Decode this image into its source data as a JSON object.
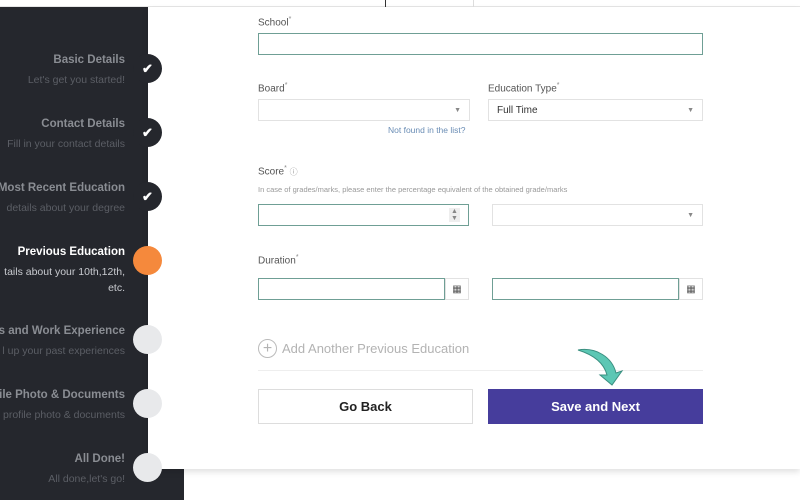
{
  "steps": [
    {
      "title": "Basic Details",
      "subtitle": "Let's get you started!",
      "state": "done"
    },
    {
      "title": "Contact Details",
      "subtitle": "Fill in your contact details",
      "state": "done"
    },
    {
      "title": "/ Most Recent Education",
      "subtitle": "details about your degree",
      "state": "done"
    },
    {
      "title": "Previous Education",
      "subtitle": "tails about your 10th,12th,",
      "subtitle2": "etc.",
      "state": "current"
    },
    {
      "title": "ps and Work Experience",
      "subtitle": "l up your past experiences",
      "state": "todo"
    },
    {
      "title": "ofile Photo & Documents",
      "subtitle": "profile photo & documents",
      "state": "todo"
    },
    {
      "title": "All Done!",
      "subtitle": "All done,let's go!",
      "state": "todo"
    }
  ],
  "form": {
    "school_label": "School",
    "required_mark": "*",
    "board_label": "Board",
    "board_value": "",
    "education_type_label": "Education Type",
    "education_type_value": "Full Time",
    "not_found_link": "Not found in the list?",
    "score_label": "Score",
    "score_hint": "In case of grades/marks, please enter the percentage equivalent of the obtained grade/marks",
    "duration_label": "Duration",
    "add_another": "Add Another Previous Education",
    "go_back": "Go Back",
    "save_next": "Save and Next"
  },
  "colors": {
    "sidebar": "#25272d",
    "current_step": "#f5893c",
    "primary_button": "#463d9c",
    "focus_border": "#6f9f95",
    "arrow": "#5cc7b4"
  },
  "icons": {
    "done": "check-icon",
    "calendar": "calendar-icon",
    "add": "plus-circle-icon",
    "info": "info-icon"
  }
}
